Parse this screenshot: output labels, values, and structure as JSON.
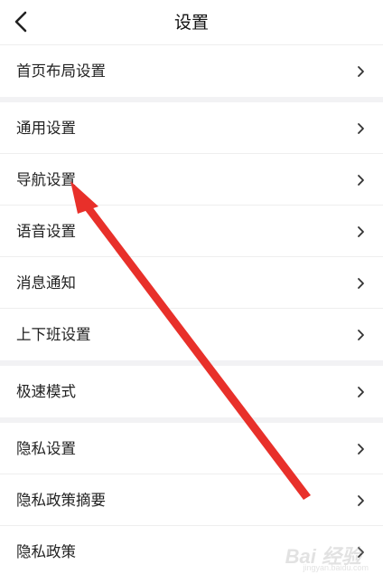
{
  "header": {
    "title": "设置",
    "back_icon": "chevron-left-icon"
  },
  "groups": [
    {
      "items": [
        {
          "label": "首页布局设置"
        }
      ]
    },
    {
      "items": [
        {
          "label": "通用设置"
        },
        {
          "label": "导航设置"
        },
        {
          "label": "语音设置"
        },
        {
          "label": "消息通知"
        },
        {
          "label": "上下班设置"
        }
      ]
    },
    {
      "items": [
        {
          "label": "极速模式"
        }
      ]
    },
    {
      "items": [
        {
          "label": "隐私设置"
        },
        {
          "label": "隐私政策摘要"
        },
        {
          "label": "隐私政策"
        }
      ]
    }
  ],
  "annotation": {
    "arrow_color": "#e8302a",
    "points_to": "导航设置"
  },
  "watermark": {
    "text": "Bai 经验",
    "subtext": "jingyan.baidu.com"
  }
}
